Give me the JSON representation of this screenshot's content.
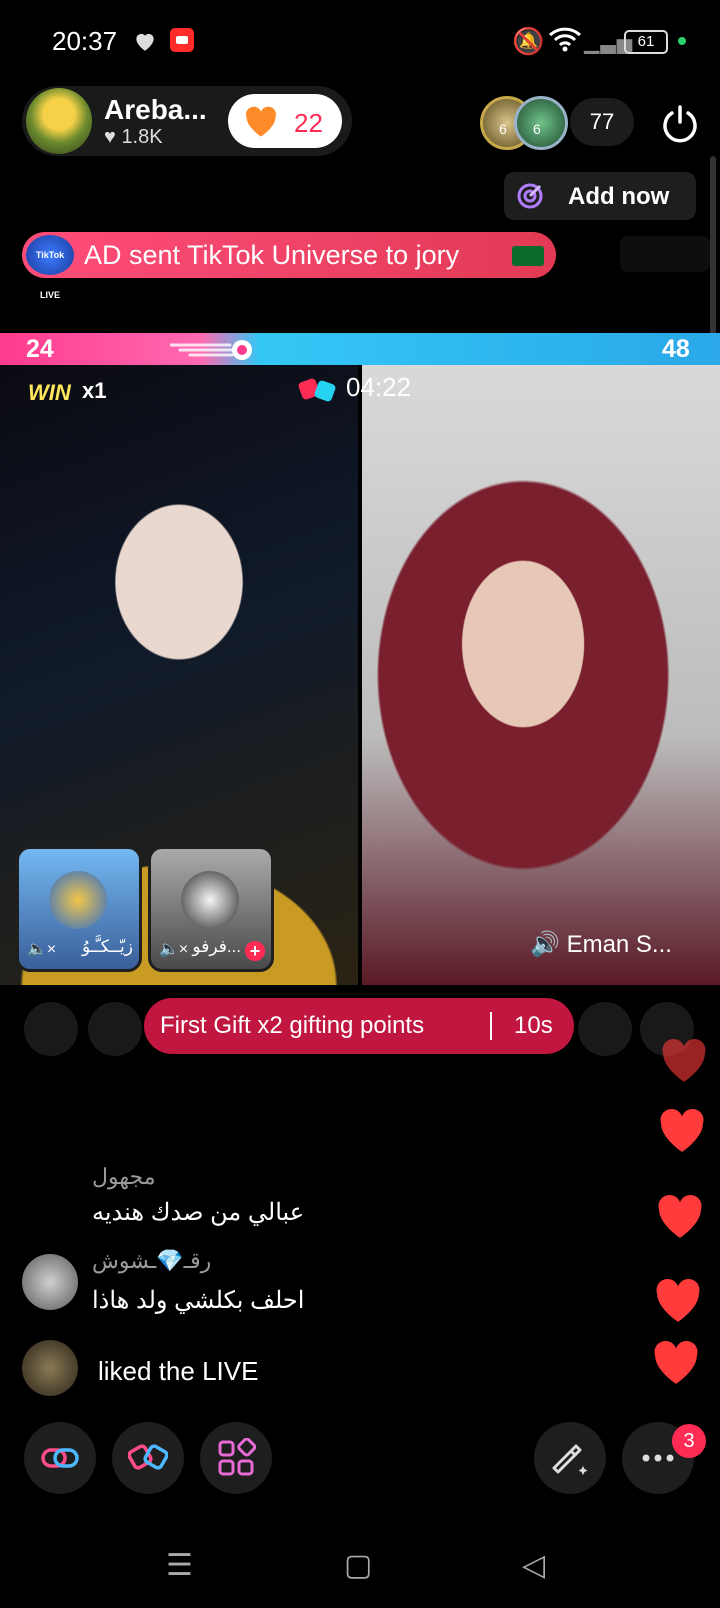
{
  "status_bar": {
    "time": "20:37",
    "battery": "61",
    "icons": [
      "heart-icon",
      "record-icon",
      "mute-bell-icon",
      "wifi-icon",
      "signal-icon",
      "battery-icon"
    ]
  },
  "host": {
    "name": "Areba...",
    "likes": "1.8K",
    "gift_count": "22"
  },
  "viewers": {
    "count": "77",
    "avatar_badges": [
      "6",
      "6"
    ]
  },
  "add_now": {
    "label": "Add now"
  },
  "banner": {
    "badge": "TikTok LIVE",
    "text": "AD sent TikTok Universe to jory"
  },
  "battle": {
    "score_left": "24",
    "score_right": "48",
    "win_label": "WIN",
    "win_multiplier": "x1",
    "timer": "04:22",
    "opponent_name": "Eman S..."
  },
  "guests": [
    {
      "name": "زيّــكـَّـوُ"
    },
    {
      "name": "فرفو..."
    }
  ],
  "first_gift": {
    "text": "First Gift x2 gifting points",
    "time": "10s"
  },
  "comments": [
    {
      "name": "مجهول",
      "text": "عبالي من صدك هنديه"
    },
    {
      "name": "رقـ💎ـشوش",
      "text": "احلف بكلشي ولد هاذا"
    },
    {
      "name": "",
      "text": "liked the LIVE"
    }
  ],
  "more_badge": "3",
  "colors": {
    "accent": "#fe2c55",
    "battle_left": "#ff3b8d",
    "battle_right": "#2aa8e8",
    "win": "#ffe65a"
  }
}
